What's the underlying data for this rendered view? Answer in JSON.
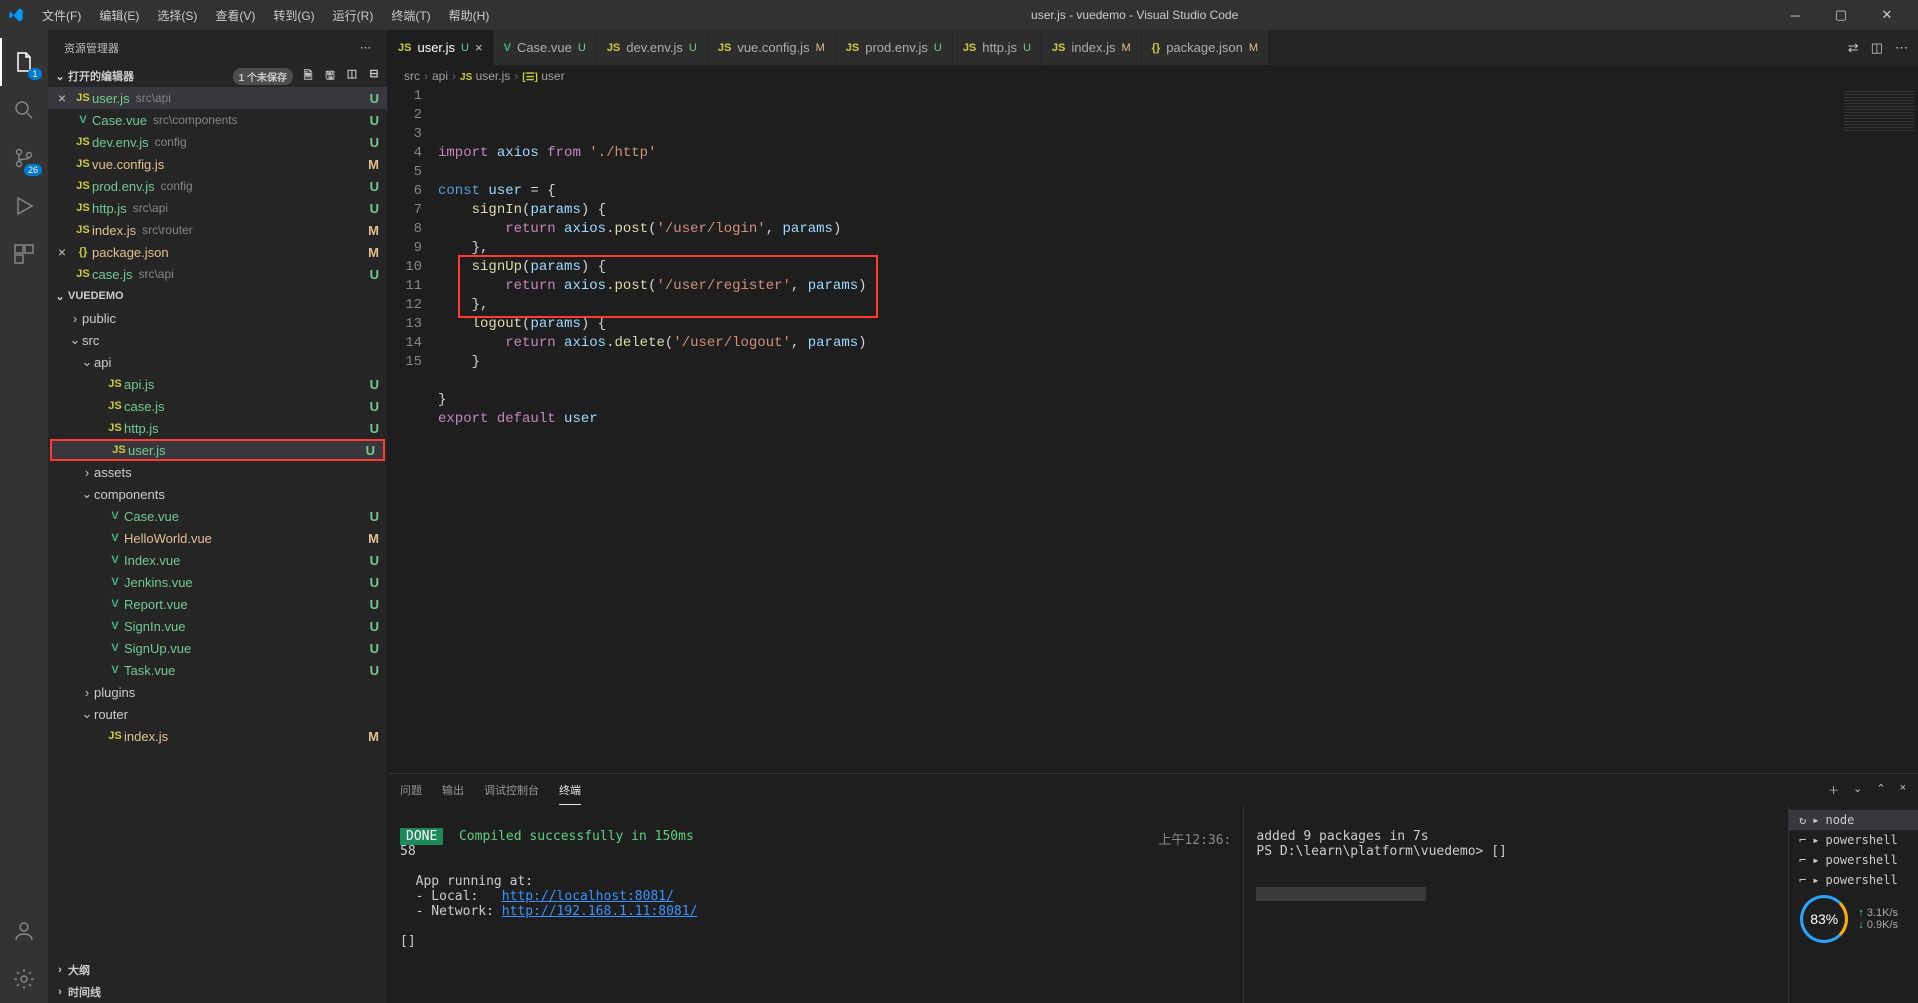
{
  "title": "user.js - vuedemo - Visual Studio Code",
  "menu": [
    "文件(F)",
    "编辑(E)",
    "选择(S)",
    "查看(V)",
    "转到(G)",
    "运行(R)",
    "终端(T)",
    "帮助(H)"
  ],
  "activity": {
    "explorer_badge": "1",
    "scm_badge": "26"
  },
  "sidebar": {
    "title": "资源管理器",
    "open_editors": {
      "label": "打开的编辑器",
      "unsaved": "1 个未保存",
      "items": [
        {
          "close": true,
          "icon": "JS",
          "iconClass": "icon-js",
          "name": "user.js",
          "path": "src\\api",
          "status": "U"
        },
        {
          "icon": "V",
          "iconClass": "icon-vue",
          "name": "Case.vue",
          "path": "src\\components",
          "status": "U"
        },
        {
          "icon": "JS",
          "iconClass": "icon-js",
          "name": "dev.env.js",
          "path": "config",
          "status": "U"
        },
        {
          "icon": "JS",
          "iconClass": "icon-js",
          "name": "vue.config.js",
          "path": "",
          "status": "M"
        },
        {
          "icon": "JS",
          "iconClass": "icon-js",
          "name": "prod.env.js",
          "path": "config",
          "status": "U"
        },
        {
          "icon": "JS",
          "iconClass": "icon-js",
          "name": "http.js",
          "path": "src\\api",
          "status": "U"
        },
        {
          "icon": "JS",
          "iconClass": "icon-js",
          "name": "index.js",
          "path": "src\\router",
          "status": "M"
        },
        {
          "close": true,
          "icon": "{}",
          "iconClass": "icon-json",
          "name": "package.json",
          "path": "",
          "status": "M"
        },
        {
          "icon": "JS",
          "iconClass": "icon-js",
          "name": "case.js",
          "path": "src\\api",
          "status": "U"
        }
      ]
    },
    "project": {
      "label": "VUEDEMO",
      "tree": [
        {
          "depth": 1,
          "chev": "›",
          "name": "public",
          "folder": true,
          "statusDot": "M"
        },
        {
          "depth": 1,
          "chev": "⌄",
          "name": "src",
          "folder": true,
          "statusDot": "M"
        },
        {
          "depth": 2,
          "chev": "⌄",
          "name": "api",
          "folder": true,
          "statusDot": "U"
        },
        {
          "depth": 3,
          "icon": "JS",
          "iconClass": "icon-js",
          "name": "api.js",
          "status": "U",
          "gitU": true
        },
        {
          "depth": 3,
          "icon": "JS",
          "iconClass": "icon-js",
          "name": "case.js",
          "status": "U",
          "gitU": true
        },
        {
          "depth": 3,
          "icon": "JS",
          "iconClass": "icon-js",
          "name": "http.js",
          "status": "U",
          "gitU": true,
          "redbox_top": true
        },
        {
          "depth": 3,
          "icon": "JS",
          "iconClass": "icon-js",
          "name": "user.js",
          "status": "U",
          "gitU": true,
          "selected": true,
          "redbox": true
        },
        {
          "depth": 2,
          "chev": "›",
          "name": "assets",
          "folder": true,
          "statusDot": "M"
        },
        {
          "depth": 2,
          "chev": "⌄",
          "name": "components",
          "folder": true,
          "statusDot": "M"
        },
        {
          "depth": 3,
          "icon": "V",
          "iconClass": "icon-vue",
          "name": "Case.vue",
          "status": "U",
          "gitU": true
        },
        {
          "depth": 3,
          "icon": "V",
          "iconClass": "icon-vue",
          "name": "HelloWorld.vue",
          "status": "M",
          "gitM": true
        },
        {
          "depth": 3,
          "icon": "V",
          "iconClass": "icon-vue",
          "name": "Index.vue",
          "status": "U",
          "gitU": true
        },
        {
          "depth": 3,
          "icon": "V",
          "iconClass": "icon-vue",
          "name": "Jenkins.vue",
          "status": "U",
          "gitU": true
        },
        {
          "depth": 3,
          "icon": "V",
          "iconClass": "icon-vue",
          "name": "Report.vue",
          "status": "U",
          "gitU": true
        },
        {
          "depth": 3,
          "icon": "V",
          "iconClass": "icon-vue",
          "name": "SignIn.vue",
          "status": "U",
          "gitU": true
        },
        {
          "depth": 3,
          "icon": "V",
          "iconClass": "icon-vue",
          "name": "SignUp.vue",
          "status": "U",
          "gitU": true
        },
        {
          "depth": 3,
          "icon": "V",
          "iconClass": "icon-vue",
          "name": "Task.vue",
          "status": "U",
          "gitU": true
        },
        {
          "depth": 2,
          "chev": "›",
          "name": "plugins",
          "folder": true,
          "statusDot": "U"
        },
        {
          "depth": 2,
          "chev": "⌄",
          "name": "router",
          "folder": true,
          "statusDot": "M"
        },
        {
          "depth": 3,
          "icon": "JS",
          "iconClass": "icon-js",
          "name": "index.js",
          "status": "M",
          "gitM": true
        }
      ]
    },
    "outline_label": "大纲",
    "timeline_label": "时间线"
  },
  "tabs": [
    {
      "icon": "JS",
      "iconClass": "icon-js",
      "name": "user.js",
      "status": "U",
      "active": true,
      "close": true
    },
    {
      "icon": "V",
      "iconClass": "icon-vue",
      "name": "Case.vue",
      "status": "U"
    },
    {
      "icon": "JS",
      "iconClass": "icon-js",
      "name": "dev.env.js",
      "status": "U"
    },
    {
      "icon": "JS",
      "iconClass": "icon-js",
      "name": "vue.config.js",
      "status": "M"
    },
    {
      "icon": "JS",
      "iconClass": "icon-js",
      "name": "prod.env.js",
      "status": "U"
    },
    {
      "icon": "JS",
      "iconClass": "icon-js",
      "name": "http.js",
      "status": "U"
    },
    {
      "icon": "JS",
      "iconClass": "icon-js",
      "name": "index.js",
      "status": "M"
    },
    {
      "icon": "{}",
      "iconClass": "icon-json",
      "name": "package.json",
      "status": "M"
    }
  ],
  "breadcrumb": [
    "src",
    "api",
    "user.js",
    "user"
  ],
  "breadcrumb_icons": [
    "",
    "",
    "JS",
    "[☰]"
  ],
  "code": {
    "lines": [
      {
        "n": 1,
        "html": "<span class='tok-kw'>import</span> <span class='tok-var'>axios</span> <span class='tok-kw'>from</span> <span class='tok-str'>'./http'</span>"
      },
      {
        "n": 2,
        "html": ""
      },
      {
        "n": 3,
        "html": "<span class='tok-const'>const</span> <span class='tok-var'>user</span> = {"
      },
      {
        "n": 4,
        "html": "    <span class='tok-fn'>signIn</span>(<span class='tok-var'>params</span>) {"
      },
      {
        "n": 5,
        "html": "        <span class='tok-kw'>return</span> <span class='tok-var'>axios</span>.<span class='tok-fn'>post</span>(<span class='tok-str'>'/user/login'</span>, <span class='tok-var'>params</span>)"
      },
      {
        "n": 6,
        "html": "    },"
      },
      {
        "n": 7,
        "html": "    <span class='tok-fn'>signUp</span>(<span class='tok-var'>params</span>) {"
      },
      {
        "n": 8,
        "html": "        <span class='tok-kw'>return</span> <span class='tok-var'>axios</span>.<span class='tok-fn'>post</span>(<span class='tok-str'>'/user/register'</span>, <span class='tok-var'>params</span>)"
      },
      {
        "n": 9,
        "html": "    },"
      },
      {
        "n": 10,
        "html": "    <span class='tok-fn'>logout</span>(<span class='tok-var'>params</span>) {"
      },
      {
        "n": 11,
        "html": "        <span class='tok-kw'>return</span> <span class='tok-var'>axios</span>.<span class='tok-fn'>delete</span>(<span class='tok-str'>'/user/logout'</span>, <span class='tok-var'>params</span>)"
      },
      {
        "n": 12,
        "html": "    }"
      },
      {
        "n": 13,
        "html": ""
      },
      {
        "n": 14,
        "html": "}"
      },
      {
        "n": 15,
        "html": "<span class='tok-kw'>export</span> <span class='tok-kw'>default</span> <span class='tok-var'>user</span>"
      }
    ],
    "highlight": {
      "startLine": 10,
      "endLine": 12
    }
  },
  "panel": {
    "tabs": [
      "问题",
      "输出",
      "调试控制台",
      "终端"
    ],
    "active_tab": 3,
    "term_left_done": "DONE",
    "term_left_compiled": "Compiled successfully in 150ms",
    "term_left_58": "58",
    "term_left_time": "上午12:36:",
    "term_left_body": "\n  App running at:\n  - Local:   ",
    "term_left_local": "http://localhost:8081/",
    "term_left_net_label": "\n  - Network: ",
    "term_left_network": "http://192.168.1.11:8081/",
    "term_left_prompt": "\n\n[]",
    "term_right_line1": "added 9 packages in 7s",
    "term_right_line2": "PS D:\\learn\\platform\\vuedemo> []",
    "term_list": [
      "node",
      "powershell",
      "powershell",
      "powershell"
    ]
  },
  "net": {
    "percent": "83%",
    "up": "3.1K/s",
    "down": "0.9K/s"
  }
}
